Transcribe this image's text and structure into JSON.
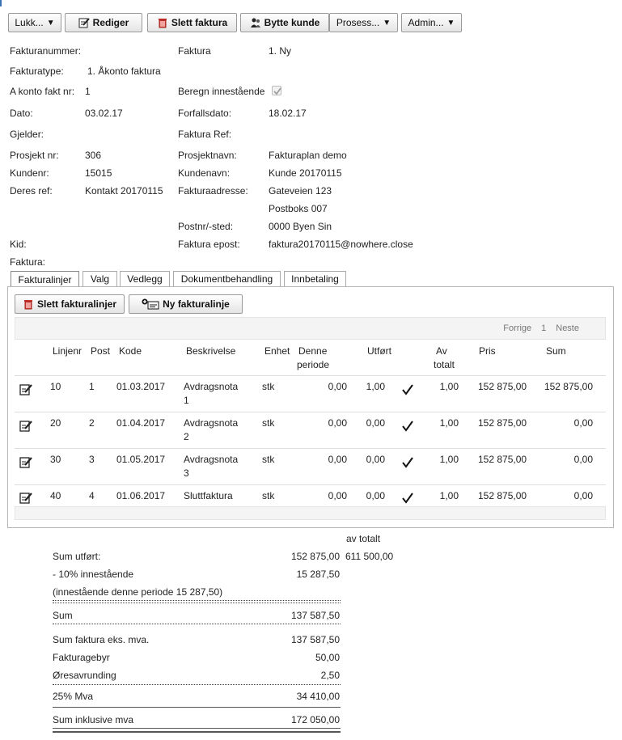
{
  "toolbar": {
    "close_label": "Lukk...",
    "edit_label": "Rediger",
    "delete_label": "Slett faktura",
    "change_customer_label": "Bytte kunde",
    "process_label": "Prosess...",
    "admin_label": "Admin..."
  },
  "header": {
    "invoice_number_label": "Fakturanummer:",
    "invoice_label": "Faktura",
    "invoice_status": "1. Ny",
    "invoice_type_label": "Fakturatype:",
    "invoice_type_value": "1. Åkonto faktura",
    "account_no_label": "A konto fakt nr:",
    "account_no_value": "1",
    "calc_retention_label": "Beregn innestående",
    "date_label": "Dato:",
    "date_value": "03.02.17",
    "due_label": "Forfallsdato:",
    "due_value": "18.02.17",
    "applies_label": "Gjelder:",
    "ref_label": "Faktura Ref:",
    "project_no_label": "Prosjekt nr:",
    "project_no_value": "306",
    "project_name_label": "Prosjektnavn:",
    "project_name_value": "Fakturaplan demo",
    "customer_no_label": "Kundenr:",
    "customer_no_value": "15015",
    "customer_name_label": "Kundenavn:",
    "customer_name_value": "Kunde 20170115",
    "your_ref_label": "Deres ref:",
    "your_ref_value": "Kontakt 20170115",
    "address_label": "Fakturaadresse:",
    "address_line1": "Gateveien 123",
    "address_line2": "Postboks 007",
    "postal_label": "Postnr/-sted:",
    "postal_value": "0000 Byen Sin",
    "kid_label": "Kid:",
    "email_label": "Faktura epost:",
    "email_value": "faktura20170115@nowhere.close",
    "invoice_colon_label": "Faktura:"
  },
  "tabs": [
    "Fakturalinjer",
    "Valg",
    "Vedlegg",
    "Dokumentbehandling",
    "Innbetaling"
  ],
  "lines_panel": {
    "delete_lines_label": "Slett fakturalinjer",
    "new_line_label": "Ny fakturalinje",
    "pager": {
      "prev": "Forrige",
      "page": "1",
      "next": "Neste"
    },
    "columns": {
      "linjenr": "Linjenr",
      "post": "Post",
      "kode": "Kode",
      "beskrivelse": "Beskrivelse",
      "enhet": "Enhet",
      "denne_1": "Denne",
      "denne_2": "periode",
      "utfort": "Utført",
      "av_1": "Av",
      "av_2": "totalt",
      "pris": "Pris",
      "sum": "Sum"
    },
    "rows": [
      {
        "linjenr": "10",
        "post": "1",
        "kode": "01.03.2017",
        "beskrivelse_1": "Avdragsnota",
        "beskrivelse_2": "1",
        "enhet": "stk",
        "denne": "0,00",
        "utfort": "1,00",
        "av_totalt": "1,00",
        "pris": "152 875,00",
        "sum": "152 875,00"
      },
      {
        "linjenr": "20",
        "post": "2",
        "kode": "01.04.2017",
        "beskrivelse_1": "Avdragsnota",
        "beskrivelse_2": "2",
        "enhet": "stk",
        "denne": "0,00",
        "utfort": "0,00",
        "av_totalt": "1,00",
        "pris": "152 875,00",
        "sum": "0,00"
      },
      {
        "linjenr": "30",
        "post": "3",
        "kode": "01.05.2017",
        "beskrivelse_1": "Avdragsnota",
        "beskrivelse_2": "3",
        "enhet": "stk",
        "denne": "0,00",
        "utfort": "0,00",
        "av_totalt": "1,00",
        "pris": "152 875,00",
        "sum": "0,00"
      },
      {
        "linjenr": "40",
        "post": "4",
        "kode": "01.06.2017",
        "beskrivelse_1": "Sluttfaktura",
        "beskrivelse_2": "",
        "enhet": "stk",
        "denne": "0,00",
        "utfort": "0,00",
        "av_totalt": "1,00",
        "pris": "152 875,00",
        "sum": "0,00"
      }
    ]
  },
  "summary": {
    "av_totalt_label": "av totalt",
    "sum_utfort_label": "Sum utført:",
    "sum_utfort_value": "152 875,00",
    "sum_utfort_total": "611 500,00",
    "retention_label": "- 10% innestående",
    "retention_value": "15 287,50",
    "retention_note": "(innestående denne periode 15 287,50)",
    "sum_label": "Sum",
    "sum_value": "137 587,50",
    "sum_ex_vat_label": "Sum faktura eks. mva.",
    "sum_ex_vat_value": "137 587,50",
    "fee_label": "Fakturagebyr",
    "fee_value": "50,00",
    "rounding_label": "Øresavrunding",
    "rounding_value": "2,50",
    "vat_label": "25% Mva",
    "vat_value": "34 410,00",
    "total_label": "Sum inklusive mva",
    "total_value": "172 050,00"
  }
}
